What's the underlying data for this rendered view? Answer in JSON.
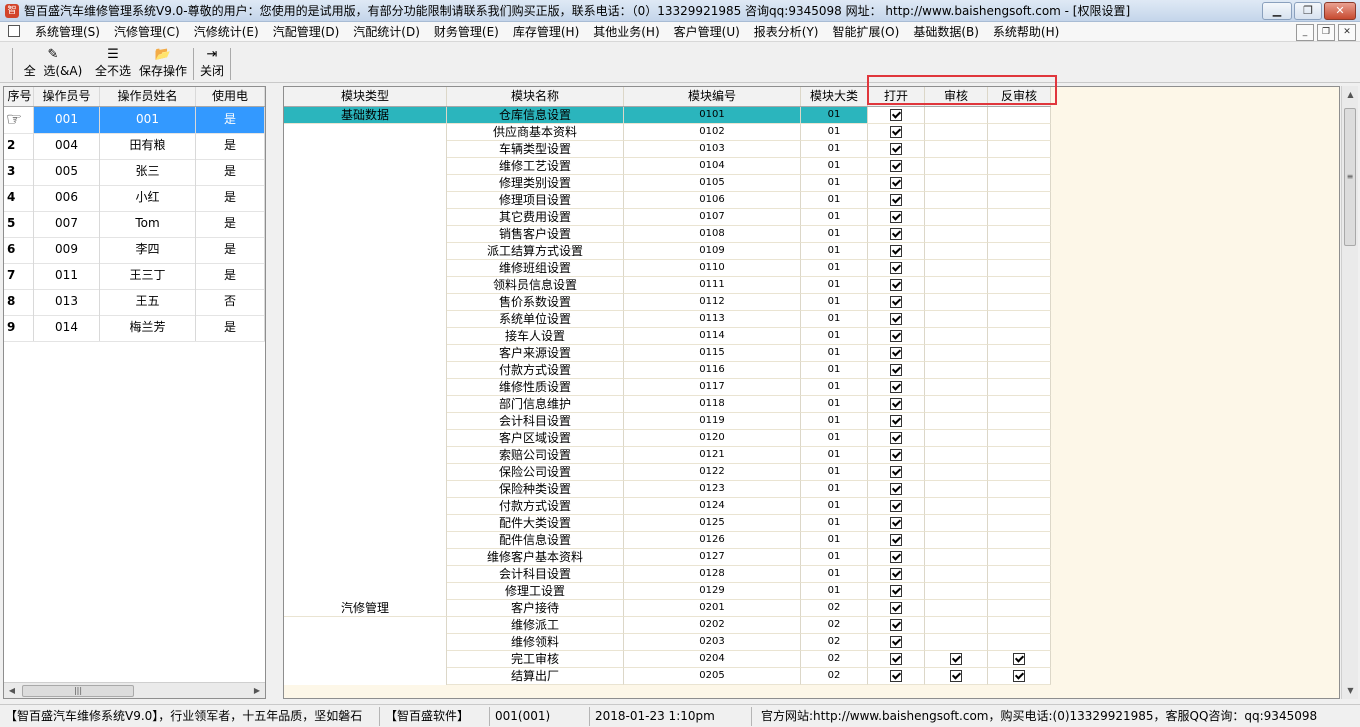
{
  "window": {
    "title": "智百盛汽车维修管理系统V9.0-尊敬的用户：您使用的是试用版，有部分功能限制请联系我们购买正版，联系电话：（0）13329921985 咨询qq:9345098    网址： http://www.baishengsoft.com - [权限设置]",
    "icon_name": "app-logo-icon",
    "minimize": "▁",
    "maximize": "❐",
    "close": "✕"
  },
  "menu": {
    "items": [
      "系统管理(S)",
      "汽修管理(C)",
      "汽修统计(E)",
      "汽配管理(D)",
      "汽配统计(D)",
      "财务管理(E)",
      "库存管理(H)",
      "其他业务(H)",
      "客户管理(U)",
      "报表分析(Y)",
      "智能扩展(O)",
      "基础数据(B)",
      "系统帮助(H)"
    ],
    "mdi": [
      "_",
      "❐",
      "✕"
    ]
  },
  "toolbar": {
    "select_all_prefix": "全",
    "select_all": "选(&A)",
    "deselect_all": "全不选",
    "save": "保存操作",
    "close": "关闭",
    "icons": {
      "select_all": "✎",
      "deselect_all": "☰",
      "save": "📂",
      "close": "⇥"
    }
  },
  "operators": {
    "columns": [
      "序号",
      "操作员号",
      "操作员姓名",
      "使用电"
    ],
    "rows": [
      {
        "seq": "",
        "id": "001",
        "name": "001",
        "use": "是"
      },
      {
        "seq": "2",
        "id": "004",
        "name": "田有粮",
        "use": "是"
      },
      {
        "seq": "3",
        "id": "005",
        "name": "张三",
        "use": "是"
      },
      {
        "seq": "4",
        "id": "006",
        "name": "小红",
        "use": "是"
      },
      {
        "seq": "5",
        "id": "007",
        "name": "Tom",
        "use": "是"
      },
      {
        "seq": "6",
        "id": "009",
        "name": "李四",
        "use": "是"
      },
      {
        "seq": "7",
        "id": "011",
        "name": "王三丁",
        "use": "是"
      },
      {
        "seq": "8",
        "id": "013",
        "name": "王五",
        "use": "否"
      },
      {
        "seq": "9",
        "id": "014",
        "name": "梅兰芳",
        "use": "是"
      }
    ],
    "selected_index": 0,
    "pointer_icon": "☞",
    "hscroll_arrows": [
      "◀",
      "▶"
    ],
    "hscroll_thumb": "|||"
  },
  "modules": {
    "columns": [
      "模块类型",
      "模块名称",
      "模块编号",
      "模块大类",
      "打开",
      "审核",
      "反审核"
    ],
    "selected_index": 0,
    "rows": [
      {
        "type": "基础数据",
        "name": "仓库信息设置",
        "code": "0101",
        "cat": "01",
        "open": true,
        "audit": false,
        "unaudit": false
      },
      {
        "type": "",
        "name": "供应商基本资料",
        "code": "0102",
        "cat": "01",
        "open": true,
        "audit": false,
        "unaudit": false
      },
      {
        "type": "",
        "name": "车辆类型设置",
        "code": "0103",
        "cat": "01",
        "open": true,
        "audit": false,
        "unaudit": false
      },
      {
        "type": "",
        "name": "维修工艺设置",
        "code": "0104",
        "cat": "01",
        "open": true,
        "audit": false,
        "unaudit": false
      },
      {
        "type": "",
        "name": "修理类别设置",
        "code": "0105",
        "cat": "01",
        "open": true,
        "audit": false,
        "unaudit": false
      },
      {
        "type": "",
        "name": "修理项目设置",
        "code": "0106",
        "cat": "01",
        "open": true,
        "audit": false,
        "unaudit": false
      },
      {
        "type": "",
        "name": "其它费用设置",
        "code": "0107",
        "cat": "01",
        "open": true,
        "audit": false,
        "unaudit": false
      },
      {
        "type": "",
        "name": "销售客户设置",
        "code": "0108",
        "cat": "01",
        "open": true,
        "audit": false,
        "unaudit": false
      },
      {
        "type": "",
        "name": "派工结算方式设置",
        "code": "0109",
        "cat": "01",
        "open": true,
        "audit": false,
        "unaudit": false
      },
      {
        "type": "",
        "name": "维修班组设置",
        "code": "0110",
        "cat": "01",
        "open": true,
        "audit": false,
        "unaudit": false
      },
      {
        "type": "",
        "name": "领料员信息设置",
        "code": "0111",
        "cat": "01",
        "open": true,
        "audit": false,
        "unaudit": false
      },
      {
        "type": "",
        "name": "售价系数设置",
        "code": "0112",
        "cat": "01",
        "open": true,
        "audit": false,
        "unaudit": false
      },
      {
        "type": "",
        "name": "系统单位设置",
        "code": "0113",
        "cat": "01",
        "open": true,
        "audit": false,
        "unaudit": false
      },
      {
        "type": "",
        "name": "接车人设置",
        "code": "0114",
        "cat": "01",
        "open": true,
        "audit": false,
        "unaudit": false
      },
      {
        "type": "",
        "name": "客户来源设置",
        "code": "0115",
        "cat": "01",
        "open": true,
        "audit": false,
        "unaudit": false
      },
      {
        "type": "",
        "name": "付款方式设置",
        "code": "0116",
        "cat": "01",
        "open": true,
        "audit": false,
        "unaudit": false
      },
      {
        "type": "",
        "name": "维修性质设置",
        "code": "0117",
        "cat": "01",
        "open": true,
        "audit": false,
        "unaudit": false
      },
      {
        "type": "",
        "name": "部门信息维护",
        "code": "0118",
        "cat": "01",
        "open": true,
        "audit": false,
        "unaudit": false
      },
      {
        "type": "",
        "name": "会计科目设置",
        "code": "0119",
        "cat": "01",
        "open": true,
        "audit": false,
        "unaudit": false
      },
      {
        "type": "",
        "name": "客户区域设置",
        "code": "0120",
        "cat": "01",
        "open": true,
        "audit": false,
        "unaudit": false
      },
      {
        "type": "",
        "name": "索赔公司设置",
        "code": "0121",
        "cat": "01",
        "open": true,
        "audit": false,
        "unaudit": false
      },
      {
        "type": "",
        "name": "保险公司设置",
        "code": "0122",
        "cat": "01",
        "open": true,
        "audit": false,
        "unaudit": false
      },
      {
        "type": "",
        "name": "保险种类设置",
        "code": "0123",
        "cat": "01",
        "open": true,
        "audit": false,
        "unaudit": false
      },
      {
        "type": "",
        "name": "付款方式设置",
        "code": "0124",
        "cat": "01",
        "open": true,
        "audit": false,
        "unaudit": false
      },
      {
        "type": "",
        "name": "配件大类设置",
        "code": "0125",
        "cat": "01",
        "open": true,
        "audit": false,
        "unaudit": false
      },
      {
        "type": "",
        "name": "配件信息设置",
        "code": "0126",
        "cat": "01",
        "open": true,
        "audit": false,
        "unaudit": false
      },
      {
        "type": "",
        "name": "维修客户基本资料",
        "code": "0127",
        "cat": "01",
        "open": true,
        "audit": false,
        "unaudit": false
      },
      {
        "type": "",
        "name": "会计科目设置",
        "code": "0128",
        "cat": "01",
        "open": true,
        "audit": false,
        "unaudit": false
      },
      {
        "type": "",
        "name": "修理工设置",
        "code": "0129",
        "cat": "01",
        "open": true,
        "audit": false,
        "unaudit": false
      },
      {
        "type": "汽修管理",
        "name": "客户接待",
        "code": "0201",
        "cat": "02",
        "open": true,
        "audit": false,
        "unaudit": false
      },
      {
        "type": "",
        "name": "维修派工",
        "code": "0202",
        "cat": "02",
        "open": true,
        "audit": false,
        "unaudit": false
      },
      {
        "type": "",
        "name": "维修领料",
        "code": "0203",
        "cat": "02",
        "open": true,
        "audit": false,
        "unaudit": false
      },
      {
        "type": "",
        "name": "完工审核",
        "code": "0204",
        "cat": "02",
        "open": true,
        "audit": true,
        "unaudit": true
      },
      {
        "type": "",
        "name": "结算出厂",
        "code": "0205",
        "cat": "02",
        "open": true,
        "audit": true,
        "unaudit": true
      }
    ],
    "scroll_arrows": [
      "▲",
      "▼"
    ],
    "scroll_thumb": "≡",
    "highlight_color": "#e0363c",
    "selection_color": "#2bb5bd"
  },
  "status": {
    "slogan": "【智百盛汽车维修系统V9.0】，行业领军者，十五年品质，坚如磐石",
    "brand": "【智百盛软件】",
    "user": "001(001)",
    "datetime": "2018-01-23 1:10pm",
    "contact": "官方网站:http://www.baishengsoft.com，购买电话:(0)13329921985，客服QQ咨询：qq:9345098"
  }
}
